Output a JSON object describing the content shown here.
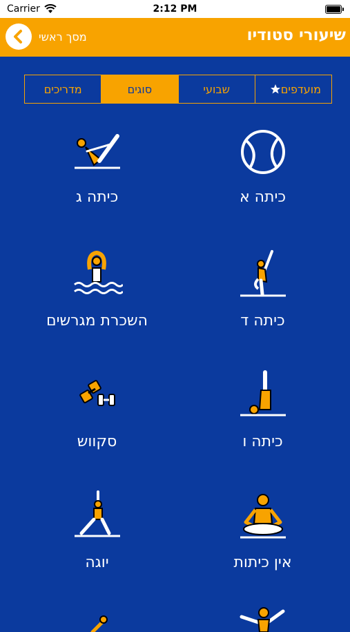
{
  "status_bar": {
    "carrier": "Carrier",
    "time": "2:12 PM"
  },
  "nav": {
    "title": "שיעורי סטודיו",
    "back_label": "מסך ראשי"
  },
  "tabs": [
    {
      "label": "מועדפים",
      "icon": "star-icon",
      "active": false
    },
    {
      "label": "שבועי",
      "active": false
    },
    {
      "label": "סוגים",
      "active": true
    },
    {
      "label": "מדריכים",
      "active": false
    }
  ],
  "categories": [
    {
      "label": "כיתה א",
      "icon": "ball-icon"
    },
    {
      "label": "כיתה ג",
      "icon": "pilates-boat-pose-icon"
    },
    {
      "label": "כיתה ד",
      "icon": "stretch-pose-icon"
    },
    {
      "label": "השכרת מגרשים",
      "icon": "swimmer-icon"
    },
    {
      "label": "כיתה ו",
      "icon": "shoulder-stand-icon"
    },
    {
      "label": "סקווש",
      "icon": "dumbbells-icon"
    },
    {
      "label": "אין כיתות",
      "icon": "meditation-icon"
    },
    {
      "label": "יוגה",
      "icon": "warrior-pose-icon"
    }
  ],
  "colors": {
    "accent": "#f8a300",
    "background": "#0b3a9e"
  }
}
